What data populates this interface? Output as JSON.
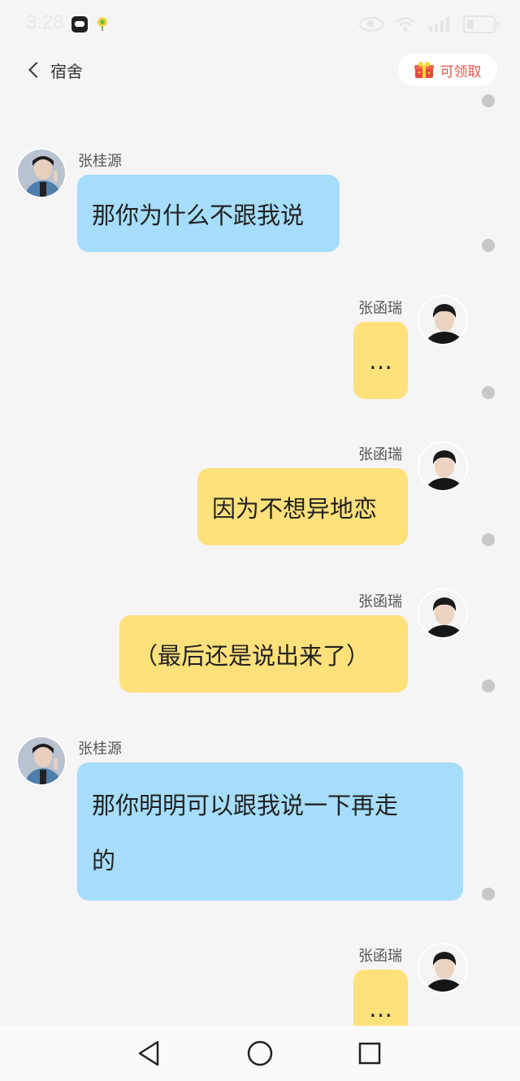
{
  "status_bar": {
    "time": "3:28"
  },
  "nav": {
    "back_title": "宿舍",
    "reward_label": "可领取"
  },
  "messages": [
    {
      "sender": "张桂源",
      "text": "那你为什么不跟我说",
      "side": "left"
    },
    {
      "sender": "张函瑞",
      "text": "…",
      "side": "right"
    },
    {
      "sender": "张函瑞",
      "text": "因为不想异地恋",
      "side": "right"
    },
    {
      "sender": "张函瑞",
      "text": "（最后还是说出来了）",
      "side": "right"
    },
    {
      "sender": "张桂源",
      "line1": "那你明明可以跟我说一下再走",
      "line2": "的",
      "side": "left"
    },
    {
      "sender": "张函瑞",
      "text": "…",
      "side": "right"
    }
  ],
  "colors": {
    "left_bubble": "#a5ddfb",
    "right_bubble": "#ffe17b",
    "reward_text": "#e2564a",
    "background": "#f5f5f5"
  },
  "icons": [
    "back-chevron-icon",
    "gift-icon",
    "eye-icon",
    "wifi-icon",
    "signal-icon",
    "battery-icon",
    "system-back-icon",
    "system-home-icon",
    "system-recents-icon"
  ]
}
